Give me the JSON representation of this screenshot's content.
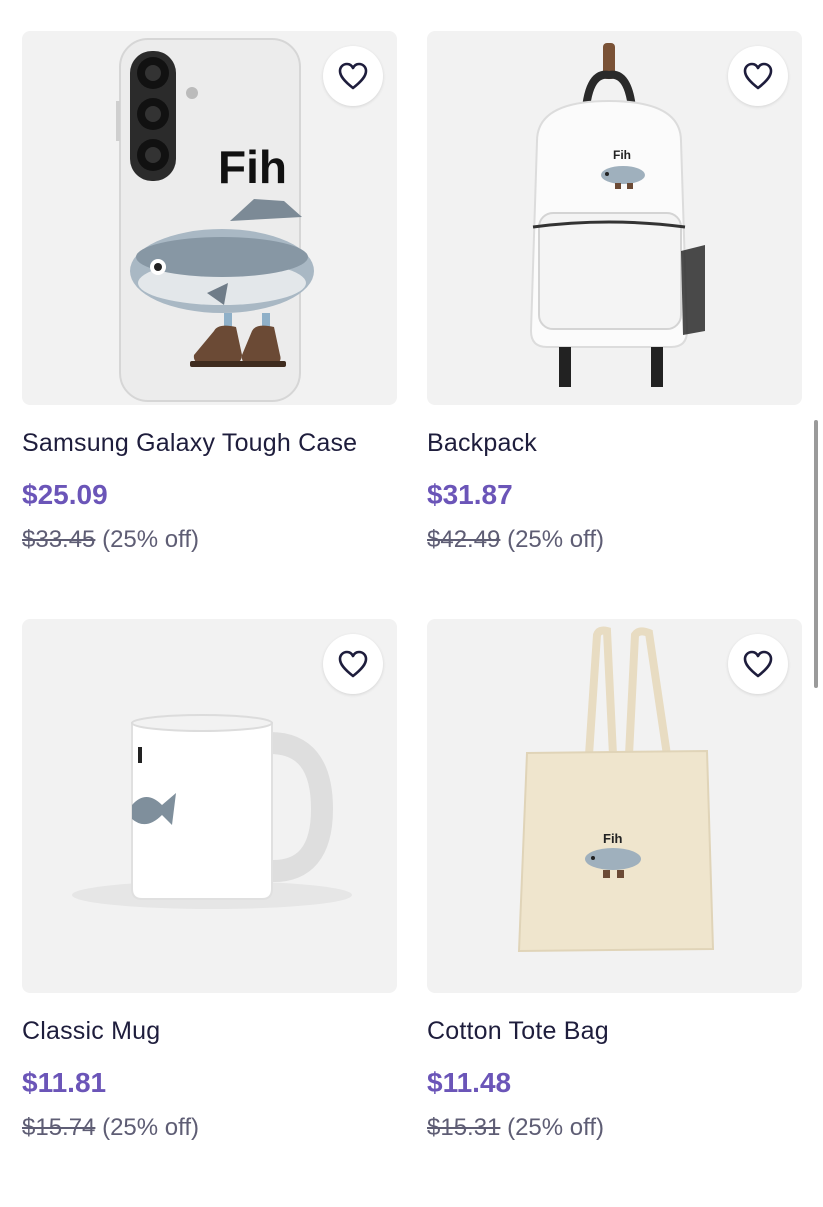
{
  "products": [
    {
      "title": "Samsung Galaxy Tough Case",
      "price": "$25.09",
      "original_price": "$33.45",
      "discount": "(25% off)",
      "design_text": "Fih"
    },
    {
      "title": "Backpack",
      "price": "$31.87",
      "original_price": "$42.49",
      "discount": "(25% off)",
      "design_text": "Fih"
    },
    {
      "title": "Classic Mug",
      "price": "$11.81",
      "original_price": "$15.74",
      "discount": "(25% off)",
      "design_text": ""
    },
    {
      "title": "Cotton Tote Bag",
      "price": "$11.48",
      "original_price": "$15.31",
      "discount": "(25% off)",
      "design_text": "Fih"
    }
  ],
  "colors": {
    "price": "#6b55b8",
    "title": "#1e1d3c",
    "muted": "#5e5d74",
    "card_bg": "#f2f2f2"
  },
  "icons": {
    "favorite": "heart-outline-icon"
  }
}
